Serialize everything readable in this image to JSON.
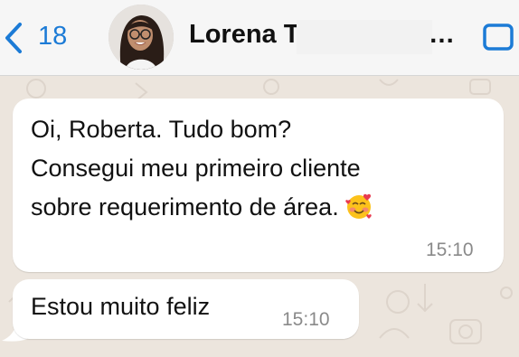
{
  "header": {
    "back_count": "18",
    "contact_name": "Lorena T",
    "name_ellipsis": "…",
    "back_icon": "chevron-left-icon",
    "video_icon": "video-camera-icon",
    "accent_color": "#1c7bd6"
  },
  "messages": [
    {
      "lines": [
        "Oi, Roberta. Tudo bom?",
        "Consegui meu primeiro cliente",
        "sobre requerimento de área."
      ],
      "emoji": "smiling-face-with-hearts",
      "time": "15:10"
    },
    {
      "lines": [
        "Estou muito feliz"
      ],
      "time": "15:10"
    }
  ]
}
